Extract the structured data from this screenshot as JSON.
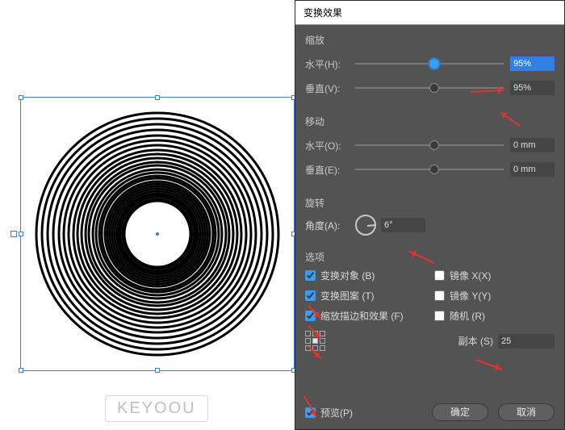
{
  "dialog": {
    "title": "变换效果",
    "scale": {
      "section_label": "缩放",
      "horizontal": {
        "label": "水平(H):",
        "value": "95%"
      },
      "vertical": {
        "label": "垂直(V):",
        "value": "95%"
      }
    },
    "move": {
      "section_label": "移动",
      "horizontal": {
        "label": "水平(O):",
        "value": "0 mm"
      },
      "vertical": {
        "label": "垂直(E):",
        "value": "0 mm"
      }
    },
    "rotate": {
      "section_label": "旋转",
      "angle_label": "角度(A):",
      "angle_value": "6°"
    },
    "options": {
      "section_label": "选项",
      "transform_object": "变换对象 (B)",
      "transform_pattern": "变换图案 (T)",
      "scale_strokes": "缩放描边和效果 (F)",
      "mirror_x": "镜像 X(X)",
      "mirror_y": "镜像 Y(Y)",
      "random": "随机 (R)",
      "copies_label": "副本 (S)",
      "copies_value": "25"
    },
    "footer": {
      "preview": "预览(P)",
      "ok": "确定",
      "cancel": "取消"
    }
  },
  "logo": "KEYOOU"
}
